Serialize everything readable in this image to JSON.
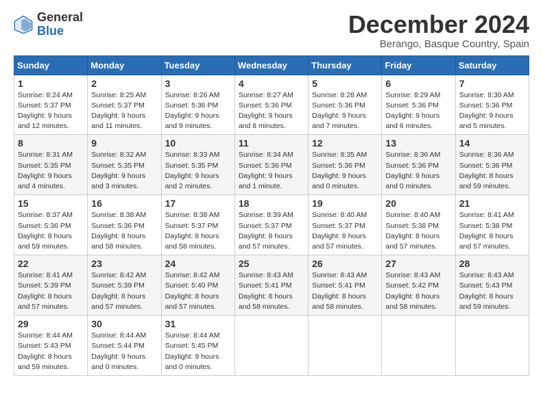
{
  "logo": {
    "general": "General",
    "blue": "Blue"
  },
  "title": "December 2024",
  "subtitle": "Berango, Basque Country, Spain",
  "headers": [
    "Sunday",
    "Monday",
    "Tuesday",
    "Wednesday",
    "Thursday",
    "Friday",
    "Saturday"
  ],
  "weeks": [
    [
      {
        "day": "1",
        "sunrise": "Sunrise: 8:24 AM",
        "sunset": "Sunset: 5:37 PM",
        "daylight": "Daylight: 9 hours and 12 minutes."
      },
      {
        "day": "2",
        "sunrise": "Sunrise: 8:25 AM",
        "sunset": "Sunset: 5:37 PM",
        "daylight": "Daylight: 9 hours and 11 minutes."
      },
      {
        "day": "3",
        "sunrise": "Sunrise: 8:26 AM",
        "sunset": "Sunset: 5:36 PM",
        "daylight": "Daylight: 9 hours and 9 minutes."
      },
      {
        "day": "4",
        "sunrise": "Sunrise: 8:27 AM",
        "sunset": "Sunset: 5:36 PM",
        "daylight": "Daylight: 9 hours and 8 minutes."
      },
      {
        "day": "5",
        "sunrise": "Sunrise: 8:28 AM",
        "sunset": "Sunset: 5:36 PM",
        "daylight": "Daylight: 9 hours and 7 minutes."
      },
      {
        "day": "6",
        "sunrise": "Sunrise: 8:29 AM",
        "sunset": "Sunset: 5:36 PM",
        "daylight": "Daylight: 9 hours and 6 minutes."
      },
      {
        "day": "7",
        "sunrise": "Sunrise: 8:30 AM",
        "sunset": "Sunset: 5:36 PM",
        "daylight": "Daylight: 9 hours and 5 minutes."
      }
    ],
    [
      {
        "day": "8",
        "sunrise": "Sunrise: 8:31 AM",
        "sunset": "Sunset: 5:35 PM",
        "daylight": "Daylight: 9 hours and 4 minutes."
      },
      {
        "day": "9",
        "sunrise": "Sunrise: 8:32 AM",
        "sunset": "Sunset: 5:35 PM",
        "daylight": "Daylight: 9 hours and 3 minutes."
      },
      {
        "day": "10",
        "sunrise": "Sunrise: 8:33 AM",
        "sunset": "Sunset: 5:35 PM",
        "daylight": "Daylight: 9 hours and 2 minutes."
      },
      {
        "day": "11",
        "sunrise": "Sunrise: 8:34 AM",
        "sunset": "Sunset: 5:36 PM",
        "daylight": "Daylight: 9 hours and 1 minute."
      },
      {
        "day": "12",
        "sunrise": "Sunrise: 8:35 AM",
        "sunset": "Sunset: 5:36 PM",
        "daylight": "Daylight: 9 hours and 0 minutes."
      },
      {
        "day": "13",
        "sunrise": "Sunrise: 8:36 AM",
        "sunset": "Sunset: 5:36 PM",
        "daylight": "Daylight: 9 hours and 0 minutes."
      },
      {
        "day": "14",
        "sunrise": "Sunrise: 8:36 AM",
        "sunset": "Sunset: 5:36 PM",
        "daylight": "Daylight: 8 hours and 59 minutes."
      }
    ],
    [
      {
        "day": "15",
        "sunrise": "Sunrise: 8:37 AM",
        "sunset": "Sunset: 5:36 PM",
        "daylight": "Daylight: 8 hours and 59 minutes."
      },
      {
        "day": "16",
        "sunrise": "Sunrise: 8:38 AM",
        "sunset": "Sunset: 5:36 PM",
        "daylight": "Daylight: 8 hours and 58 minutes."
      },
      {
        "day": "17",
        "sunrise": "Sunrise: 8:38 AM",
        "sunset": "Sunset: 5:37 PM",
        "daylight": "Daylight: 8 hours and 58 minutes."
      },
      {
        "day": "18",
        "sunrise": "Sunrise: 8:39 AM",
        "sunset": "Sunset: 5:37 PM",
        "daylight": "Daylight: 8 hours and 57 minutes."
      },
      {
        "day": "19",
        "sunrise": "Sunrise: 8:40 AM",
        "sunset": "Sunset: 5:37 PM",
        "daylight": "Daylight: 8 hours and 57 minutes."
      },
      {
        "day": "20",
        "sunrise": "Sunrise: 8:40 AM",
        "sunset": "Sunset: 5:38 PM",
        "daylight": "Daylight: 8 hours and 57 minutes."
      },
      {
        "day": "21",
        "sunrise": "Sunrise: 8:41 AM",
        "sunset": "Sunset: 5:38 PM",
        "daylight": "Daylight: 8 hours and 57 minutes."
      }
    ],
    [
      {
        "day": "22",
        "sunrise": "Sunrise: 8:41 AM",
        "sunset": "Sunset: 5:39 PM",
        "daylight": "Daylight: 8 hours and 57 minutes."
      },
      {
        "day": "23",
        "sunrise": "Sunrise: 8:42 AM",
        "sunset": "Sunset: 5:39 PM",
        "daylight": "Daylight: 8 hours and 57 minutes."
      },
      {
        "day": "24",
        "sunrise": "Sunrise: 8:42 AM",
        "sunset": "Sunset: 5:40 PM",
        "daylight": "Daylight: 8 hours and 57 minutes."
      },
      {
        "day": "25",
        "sunrise": "Sunrise: 8:43 AM",
        "sunset": "Sunset: 5:41 PM",
        "daylight": "Daylight: 8 hours and 58 minutes."
      },
      {
        "day": "26",
        "sunrise": "Sunrise: 8:43 AM",
        "sunset": "Sunset: 5:41 PM",
        "daylight": "Daylight: 8 hours and 58 minutes."
      },
      {
        "day": "27",
        "sunrise": "Sunrise: 8:43 AM",
        "sunset": "Sunset: 5:42 PM",
        "daylight": "Daylight: 8 hours and 58 minutes."
      },
      {
        "day": "28",
        "sunrise": "Sunrise: 8:43 AM",
        "sunset": "Sunset: 5:43 PM",
        "daylight": "Daylight: 8 hours and 59 minutes."
      }
    ],
    [
      {
        "day": "29",
        "sunrise": "Sunrise: 8:44 AM",
        "sunset": "Sunset: 5:43 PM",
        "daylight": "Daylight: 8 hours and 59 minutes."
      },
      {
        "day": "30",
        "sunrise": "Sunrise: 8:44 AM",
        "sunset": "Sunset: 5:44 PM",
        "daylight": "Daylight: 9 hours and 0 minutes."
      },
      {
        "day": "31",
        "sunrise": "Sunrise: 8:44 AM",
        "sunset": "Sunset: 5:45 PM",
        "daylight": "Daylight: 9 hours and 0 minutes."
      },
      null,
      null,
      null,
      null
    ]
  ]
}
